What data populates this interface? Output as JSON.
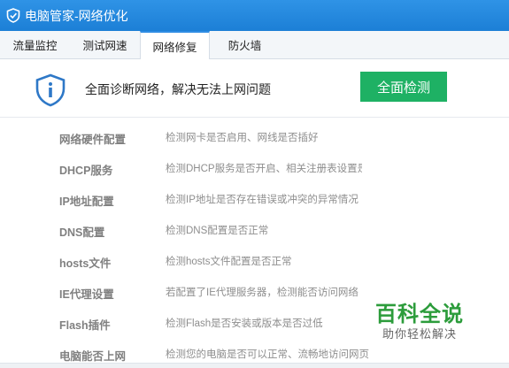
{
  "window": {
    "title": "电脑管家-网络优化",
    "logo_icon": "shield-check-icon"
  },
  "tabs": [
    {
      "label": "流量监控",
      "active": false
    },
    {
      "label": "测试网速",
      "active": false
    },
    {
      "label": "网络修复",
      "active": true
    },
    {
      "label": "防火墙",
      "active": false
    }
  ],
  "headline": {
    "icon": "shield-info-icon",
    "text": "全面诊断网络，解决无法上网问题",
    "scan_button_label": "全面检测"
  },
  "check_items": [
    {
      "name": "网络硬件配置",
      "description": "检测网卡是否启用、网线是否插好"
    },
    {
      "name": "DHCP服务",
      "description": "检测DHCP服务是否开启、相关注册表设置是否完好"
    },
    {
      "name": "IP地址配置",
      "description": "检测IP地址是否存在错误或冲突的异常情况"
    },
    {
      "name": "DNS配置",
      "description": "检测DNS配置是否正常"
    },
    {
      "name": "hosts文件",
      "description": "检测hosts文件配置是否正常"
    },
    {
      "name": "IE代理设置",
      "description": "若配置了IE代理服务器，检测能否访问网络"
    },
    {
      "name": "Flash插件",
      "description": "检测Flash是否安装或版本是否过低"
    },
    {
      "name": "电脑能否上网",
      "description": "检测您的电脑是否可以正常、流畅地访问网页"
    }
  ],
  "watermark": {
    "title": "百科全说",
    "subtitle": "助你轻松解决"
  },
  "colors": {
    "titlebar": "#2188e0",
    "accent_green": "#1eb164",
    "shield_blue": "#2e78c7"
  }
}
